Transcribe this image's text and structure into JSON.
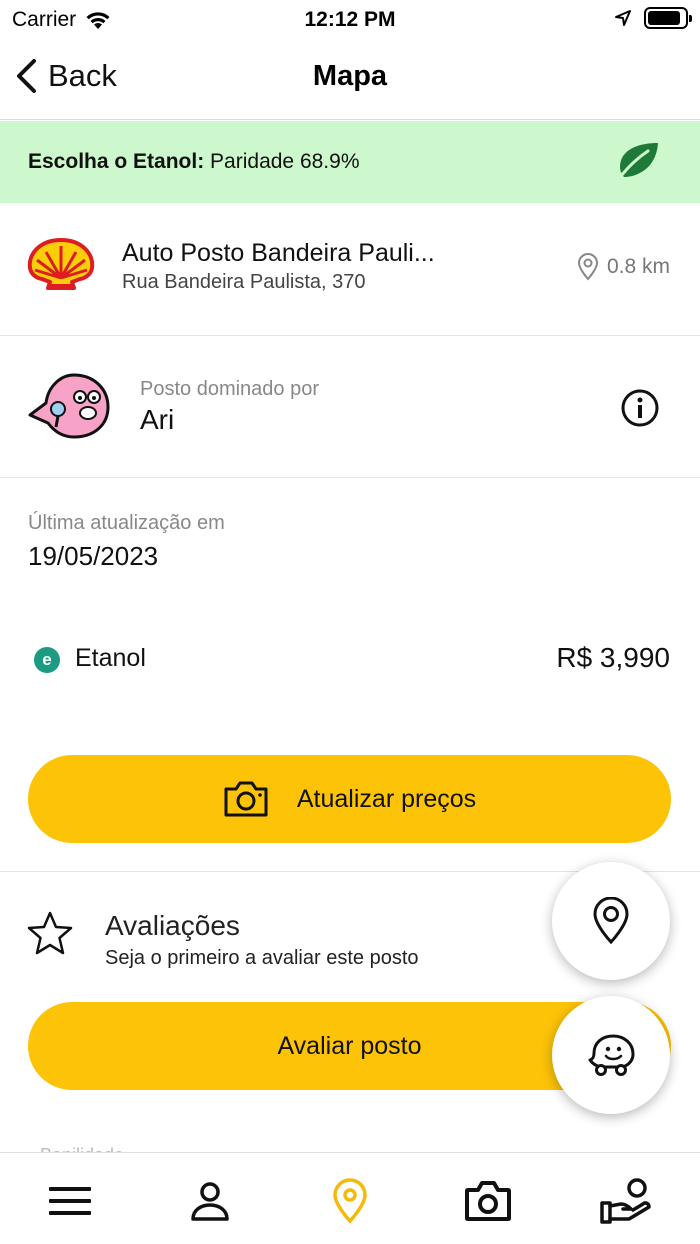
{
  "status_bar": {
    "carrier": "Carrier",
    "time": "12:12 PM",
    "battery_level": 0.9
  },
  "nav": {
    "back_label": "Back",
    "title": "Mapa"
  },
  "banner": {
    "prefix": "Escolha o Etanol:",
    "text": "Paridade 68.9%",
    "bg_color": "#cdf7cc",
    "icon": "leaf-icon"
  },
  "station": {
    "name": "Auto Posto Bandeira Pauli...",
    "address": "Rua Bandeira Paulista, 370",
    "distance": "0.8 km",
    "logo": "shell-logo"
  },
  "dominated": {
    "label": "Posto dominado por",
    "name": "Ari",
    "icon": "info-icon"
  },
  "update": {
    "label": "Última atualização em",
    "date": "19/05/2023"
  },
  "fuels": [
    {
      "badge": "e",
      "name": "Etanol",
      "price": "R$ 3,990"
    }
  ],
  "actions": {
    "update_prices": "Atualizar preços",
    "rate_station": "Avaliar posto",
    "accent_color": "#fcc307"
  },
  "ratings": {
    "title": "Avaliações",
    "subtitle": "Seja o primeiro a avaliar este posto"
  },
  "faded_text": "Banilidade",
  "tabs": [
    {
      "icon": "menu-icon"
    },
    {
      "icon": "profile-icon"
    },
    {
      "icon": "map-pin-icon",
      "active": true
    },
    {
      "icon": "camera-icon"
    },
    {
      "icon": "rewards-icon"
    }
  ]
}
